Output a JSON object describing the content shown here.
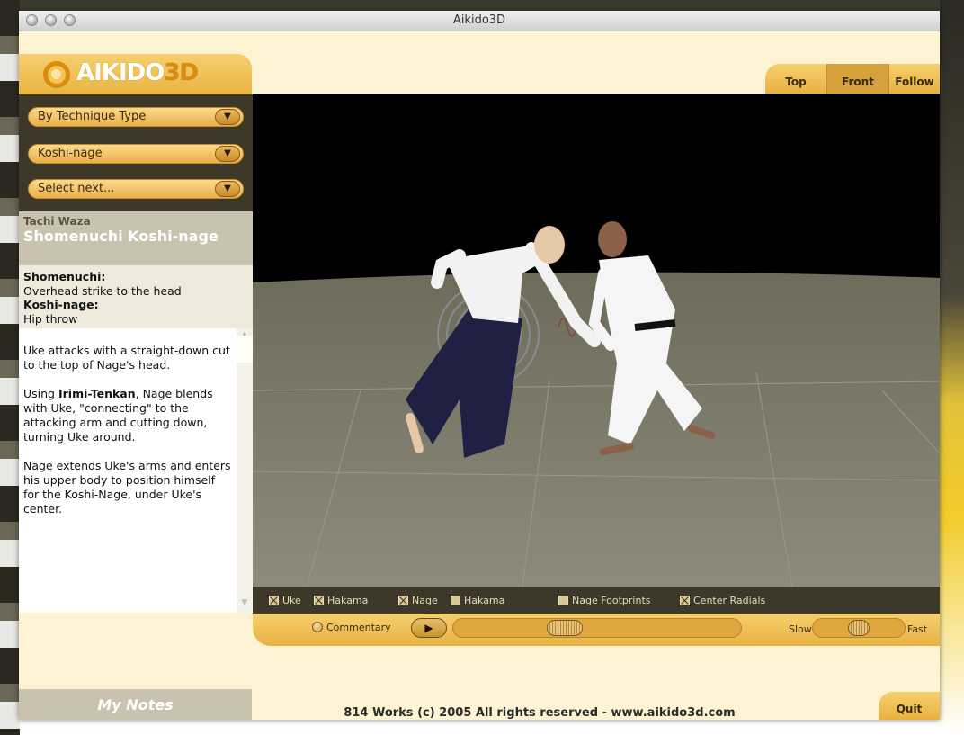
{
  "window": {
    "title": "Aikido3D"
  },
  "logo": {
    "text_main": "AIKIDO",
    "text_accent": "3D"
  },
  "selectors": [
    {
      "value": "By Technique Type"
    },
    {
      "value": "Koshi-nage"
    },
    {
      "value": "Select next..."
    }
  ],
  "technique": {
    "category": "Tachi Waza",
    "name": "Shomenuchi Koshi-nage"
  },
  "terms": [
    {
      "term": "Shomenuchi:",
      "definition": "Overhead strike to the head"
    },
    {
      "term": "Koshi-nage:",
      "definition": "Hip throw"
    }
  ],
  "commentary": {
    "p1": "Uke attacks with a straight-down cut to the top of Nage's head.",
    "p2_prefix": "Using ",
    "p2_bold": "Irimi-Tenkan",
    "p2_suffix": ", Nage blends with Uke, \"connecting\" to the attacking arm and cutting down, turning Uke around.",
    "p3": "Nage extends Uke's arms and enters his upper body to position himself for the Koshi-Nage, under Uke's center."
  },
  "notes": {
    "label": "My  Notes"
  },
  "view_tabs": [
    {
      "label": "Top",
      "active": false
    },
    {
      "label": "Front",
      "active": true
    },
    {
      "label": "Follow",
      "active": false
    }
  ],
  "toggles": [
    {
      "label": "Uke",
      "checked": true
    },
    {
      "label": "Hakama",
      "checked": true
    },
    {
      "label": "Nage",
      "checked": true
    },
    {
      "label": "Hakama",
      "checked": false
    },
    {
      "label": "Nage Footprints",
      "checked": false
    },
    {
      "label": "Center Radials",
      "checked": true
    }
  ],
  "controls": {
    "commentary_label": "Commentary",
    "play_glyph": "▶",
    "slow_label": "Slow",
    "fast_label": "Fast",
    "timeline_position": 0.37,
    "speed_position": 0.5
  },
  "footer": {
    "copyright": "814 Works (c) 2005 All rights reserved - www.aikido3d.com"
  },
  "quit": {
    "label": "Quit"
  },
  "colors": {
    "accent": "#e9b443",
    "panel_dark": "#3d382a",
    "panel_beige": "#c9c2ae"
  }
}
